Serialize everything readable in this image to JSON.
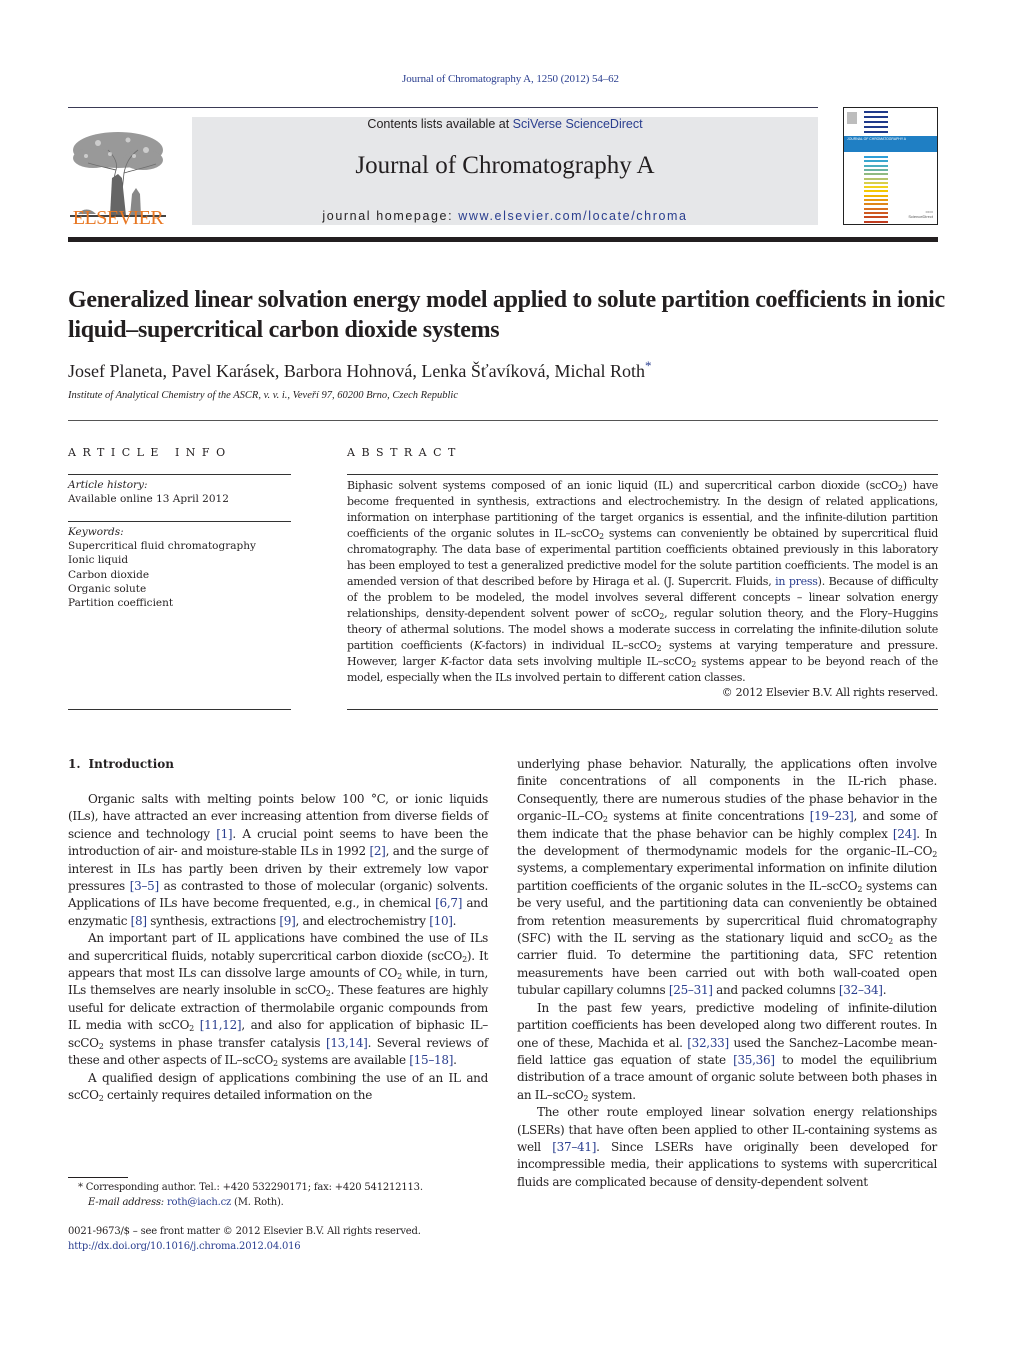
{
  "header": {
    "citation": "Journal of Chromatography A, 1250 (2012) 54–62",
    "publisher_logo_text": "ELSEVIER",
    "contents_prefix": "Contents lists available at ",
    "contents_link": "SciVerse ScienceDirect",
    "journal_name": "Journal of Chromatography A",
    "homepage_prefix": "journal homepage: ",
    "homepage_link": "www.elsevier.com/locate/chroma",
    "cover_band_text": "JOURNAL OF CHROMATOGRAPHY A",
    "cover_stripe_colors": [
      "#1f3a8a",
      "#1f3a8a",
      "#1f3a8a",
      "#1f3a8a",
      "#1f3a8a",
      "#2f9fd8",
      "#38a6cf",
      "#4aaec0",
      "#6ab3a0",
      "#8fba80",
      "#b4c36a",
      "#d8cf4a",
      "#f2d21a",
      "#f5c800",
      "#f0b400",
      "#e89a10",
      "#e08618",
      "#d87020",
      "#cf5a20",
      "#c84a20",
      "#c03c20"
    ]
  },
  "article": {
    "title": "Generalized linear solvation energy model applied to solute partition coefficients in ionic liquid–supercritical carbon dioxide systems",
    "authors": "Josef Planeta, Pavel Karásek, Barbora Hohnová, Lenka Šťavíková, Michal Roth",
    "corresponding_marker": "*",
    "affiliation": "Institute of Analytical Chemistry of the ASCR, v. v. i., Veveří 97, 60200 Brno, Czech Republic"
  },
  "article_info": {
    "heading": "ARTICLE INFO",
    "history_label": "Article history:",
    "history_value": "Available online 13 April 2012",
    "keywords_label": "Keywords:",
    "keywords": [
      "Supercritical fluid chromatography",
      "Ionic liquid",
      "Carbon dioxide",
      "Organic solute",
      "Partition coefficient"
    ]
  },
  "abstract": {
    "heading": "ABSTRACT",
    "s1": "Biphasic solvent systems composed of an ionic liquid (IL) and supercritical carbon dioxide (scCO",
    "s2": ") have become frequented in synthesis, extractions and electrochemistry. In the design of related applications, information on interphase partitioning of the target organics is essential, and the infinite-dilution partition coefficients of the organic solutes in IL–scCO",
    "s3": " systems can conveniently be obtained by supercritical fluid chromatography. The data base of experimental partition coefficients obtained previously in this laboratory has been employed to test a generalized predictive model for the solute partition coefficients. The model is an amended version of that described before by Hiraga et al. (J. Supercrit. Fluids, ",
    "in_press_link": "in press",
    "s4": "). Because of difficulty of the problem to be modeled, the model involves several different concepts – linear solvation energy relationships, density-dependent solvent power of scCO",
    "s5": ", regular solution theory, and the Flory–Huggins theory of athermal solutions. The model shows a moderate success in correlating the infinite-dilution solute partition coefficients (",
    "k1": "K",
    "s6": "-factors) in individual IL–scCO",
    "s7": " systems at varying temperature and pressure. However, larger ",
    "k2": "K",
    "s8": "-factor data sets involving multiple IL–scCO",
    "s9": " systems appear to be beyond reach of the model, especially when the ILs involved pertain to different cation classes.",
    "sub": "2",
    "copyright": "© 2012 Elsevier B.V. All rights reserved."
  },
  "introduction": {
    "number": "1.",
    "heading": "Introduction",
    "p1": {
      "a": "Organic salts with melting points below 100 °C, or ionic liquids (ILs), have attracted an ever increasing attention from diverse fields of science and technology ",
      "r1": "[1]",
      "b": ". A crucial point seems to have been the introduction of air- and moisture-stable ILs in 1992 ",
      "r2": "[2]",
      "c": ", and the surge of interest in ILs has partly been driven by their extremely low vapor pressures ",
      "r3": "[3–5]",
      "d": " as contrasted to those of molecular (organic) solvents. Applications of ILs have become frequented, e.g., in chemical ",
      "r4": "[6,7]",
      "e": " and enzymatic ",
      "r5": "[8]",
      "f": " synthesis, extractions ",
      "r6": "[9]",
      "g": ", and electrochemistry ",
      "r7": "[10]",
      "h": "."
    },
    "p2": {
      "a": "An important part of IL applications have combined the use of ILs and supercritical fluids, notably supercritical carbon dioxide (scCO",
      "b": "). It appears that most ILs can dissolve large amounts of CO",
      "c": " while, in turn, ILs themselves are nearly insoluble in scCO",
      "d": ". These features are highly useful for delicate extraction of thermolabile organic compounds from IL media with scCO",
      "r1": "[11,12]",
      "e": ", and also for application of biphasic IL–scCO",
      "f": " systems in phase transfer catalysis ",
      "r2": "[13,14]",
      "g": ". Several reviews of these and other aspects of IL–scCO",
      "h": " systems are available ",
      "r3": "[15–18]",
      "i": "."
    },
    "p3": {
      "a": "A qualified design of applications combining the use of an IL and scCO",
      "b": " certainly requires detailed information on the underlying phase behavior. Naturally, the applications often involve finite concentrations of all components in the IL-rich phase. Consequently, there are numerous studies of the phase behavior in the organic–IL–CO",
      "c": " systems at finite concentrations ",
      "r1": "[19–23]",
      "d": ", and some of them indicate that the phase behavior can be highly complex ",
      "r2": "[24]",
      "e": ". In the development of thermodynamic models for the organic–IL–CO",
      "f": " systems, a complementary experimental information on infinite dilution partition coefficients of the organic solutes in the IL–scCO",
      "g": " systems can be very useful, and the partitioning data can conveniently be obtained from retention measurements by supercritical fluid chromatography (SFC) with the IL serving as the stationary liquid and scCO",
      "h": " as the carrier fluid. To determine the partitioning data, SFC retention measurements have been carried out with both wall-coated open tubular capillary columns ",
      "r3": "[25–31]",
      "i": " and packed columns ",
      "r4": "[32–34]",
      "j": "."
    },
    "p4": {
      "a": "In the past few years, predictive modeling of infinite-dilution partition coefficients has been developed along two different routes. In one of these, Machida et al. ",
      "r1": "[32,33]",
      "b": " used the Sanchez–Lacombe mean-field lattice gas equation of state ",
      "r2": "[35,36]",
      "c": " to model the equilibrium distribution of a trace amount of organic solute between both phases in an IL–scCO",
      "d": " system."
    },
    "p5": {
      "a": "The other route employed linear solvation energy relationships (LSERs) that have often been applied to other IL-containing systems as well ",
      "r1": "[37–41]",
      "b": ". Since LSERs have originally been developed for incompressible media, their applications to systems with supercritical fluids are complicated because of density-dependent solvent"
    },
    "sub": "2"
  },
  "footnote": {
    "marker": "*",
    "text": "Corresponding author. Tel.: +420 532290171; fax: +420 541212113.",
    "email_label": "E-mail address:",
    "email": "roth@iach.cz",
    "email_suffix": " (M. Roth)."
  },
  "front_matter": {
    "issn_line": "0021-9673/$ – see front matter © 2012 Elsevier B.V. All rights reserved.",
    "doi": "http://dx.doi.org/10.1016/j.chroma.2012.04.016"
  }
}
